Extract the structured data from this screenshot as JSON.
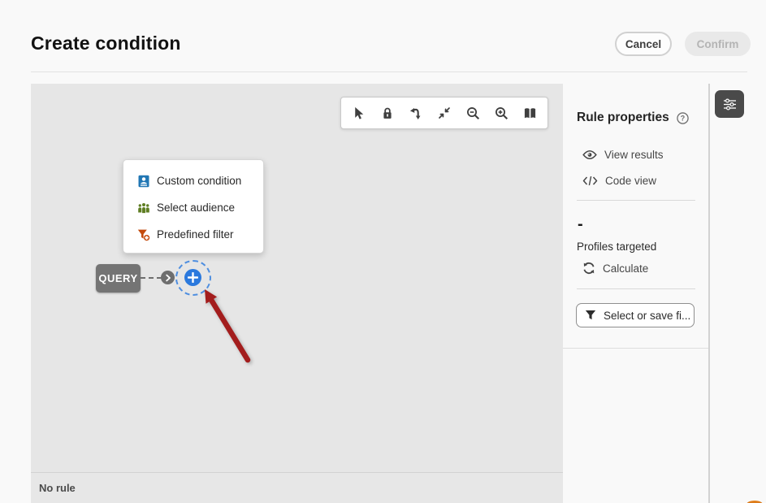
{
  "header": {
    "title": "Create condition",
    "cancel_label": "Cancel",
    "confirm_label": "Confirm"
  },
  "canvas": {
    "node_label": "QUERY",
    "no_rule_label": "No rule",
    "menu": {
      "items": [
        {
          "label": "Custom condition",
          "icon": "user-card-icon"
        },
        {
          "label": "Select audience",
          "icon": "audience-icon"
        },
        {
          "label": "Predefined filter",
          "icon": "filter-add-icon"
        }
      ]
    },
    "toolbar_icons": [
      "pointer-icon",
      "lock-icon",
      "reroute-arrow-icon",
      "collapse-icon",
      "zoom-out-icon",
      "zoom-in-icon",
      "overview-book-icon"
    ]
  },
  "sidebar": {
    "title": "Rule properties",
    "help_icon": "help-circle-icon",
    "actions": [
      {
        "label": "View results",
        "icon": "eye-icon"
      },
      {
        "label": "Code view",
        "icon": "code-icon"
      }
    ],
    "profiles": {
      "count": "-",
      "label": "Profiles targeted",
      "calculate_label": "Calculate",
      "calculate_icon": "refresh-icon"
    },
    "filter_button_label": "Select or save fi...",
    "filter_button_icon": "funnel-icon"
  },
  "rail": {
    "settings_icon": "sliders-icon"
  },
  "colors": {
    "accent_blue": "#2b79dd",
    "arrow_red": "#a31d1d",
    "node_gray": "#747474",
    "canvas_gray": "#e6e6e6",
    "menu_icon_blue": "#2277b4",
    "menu_icon_green": "#5e7d22",
    "menu_icon_orange": "#c44a0c",
    "dark_button": "#4a4a4a"
  }
}
